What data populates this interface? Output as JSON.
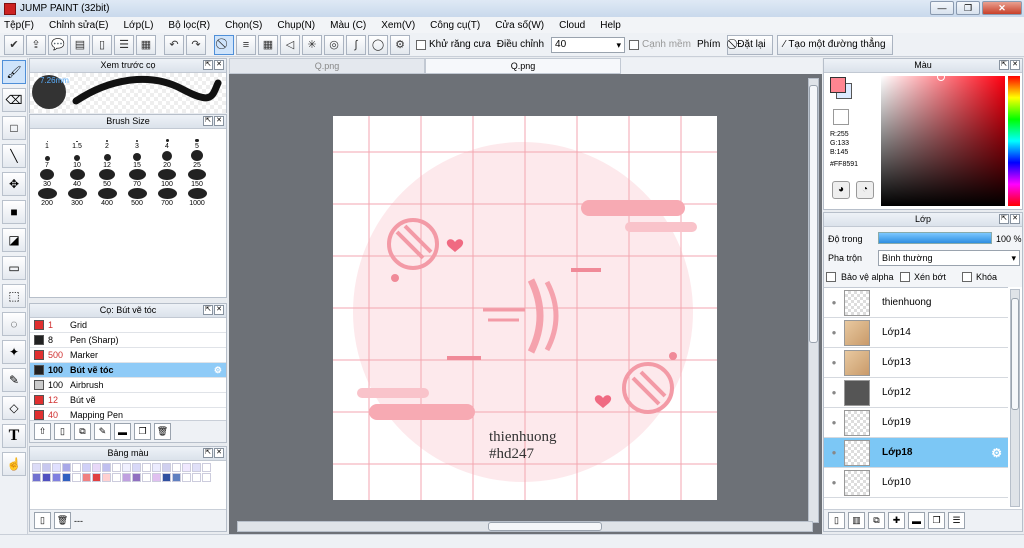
{
  "window": {
    "title": "JUMP PAINT (32bit)"
  },
  "menu": [
    "Tệp(F)",
    "Chỉnh sửa(E)",
    "Lớp(L)",
    "Bộ lọc(R)",
    "Chọn(S)",
    "Chụp(N)",
    "Màu (C)",
    "Xem(V)",
    "Công cụ(T)",
    "Cửa số(W)",
    "Cloud",
    "Help"
  ],
  "toolbar": {
    "antialias_label": "Khử răng cưa",
    "adjust_label": "Điều chỉnh",
    "adjust_value": "40",
    "edge_label": "Cạnh mềm",
    "key_label": "Phím",
    "reset_label": "Đặt lại",
    "line_label": "Tạo một đường thẳng"
  },
  "brush_preview": {
    "title": "Xem trước cọ",
    "size": "7.26mm"
  },
  "brush_size": {
    "title": "Brush Size",
    "sizes": [
      "1",
      "1.5",
      "2",
      "3",
      "4",
      "5",
      "7",
      "10",
      "12",
      "15",
      "20",
      "25",
      "30",
      "40",
      "50",
      "70",
      "100",
      "150",
      "200",
      "300",
      "400",
      "500",
      "700",
      "1000"
    ]
  },
  "brush_list": {
    "title": "Cọ: Bút vẽ tóc",
    "items": [
      {
        "size": "1",
        "name": "Grid",
        "color": "#e03030"
      },
      {
        "size": "8",
        "name": "Pen (Sharp)",
        "color": "#222222"
      },
      {
        "size": "500",
        "name": "Marker",
        "color": "#e03030"
      },
      {
        "size": "100",
        "name": "Bút vẽ tóc",
        "color": "#222222"
      },
      {
        "size": "100",
        "name": "Airbrush",
        "color": "#cccccc"
      },
      {
        "size": "12",
        "name": "Bút vẽ",
        "color": "#e03030"
      },
      {
        "size": "40",
        "name": "Mapping Pen",
        "color": "#e03030"
      }
    ]
  },
  "palette": {
    "title": "Bảng màu",
    "footer": "---"
  },
  "canvas": {
    "tabs": [
      "Q.png",
      "Q.png"
    ],
    "text_line1": "thienhuong",
    "text_line2": "#hd247"
  },
  "color_panel": {
    "title": "Màu",
    "r": "R:255",
    "g": "G:133",
    "b": "B:145",
    "hex": "#FF8591",
    "fg": "#ff8591"
  },
  "layer_panel": {
    "title": "Lớp",
    "opacity_label": "Độ trong",
    "opacity_value": "100 %",
    "opacity": 1.0,
    "blend_label": "Pha trộn",
    "blend_value": "Bình thường",
    "protect_alpha": "Bảo vệ alpha",
    "clip": "Xén bớt",
    "lock": "Khóa",
    "layers": [
      "thienhuong",
      "Lớp14",
      "Lớp13",
      "Lớp12",
      "Lớp19",
      "Lớp18",
      "Lớp10"
    ]
  }
}
